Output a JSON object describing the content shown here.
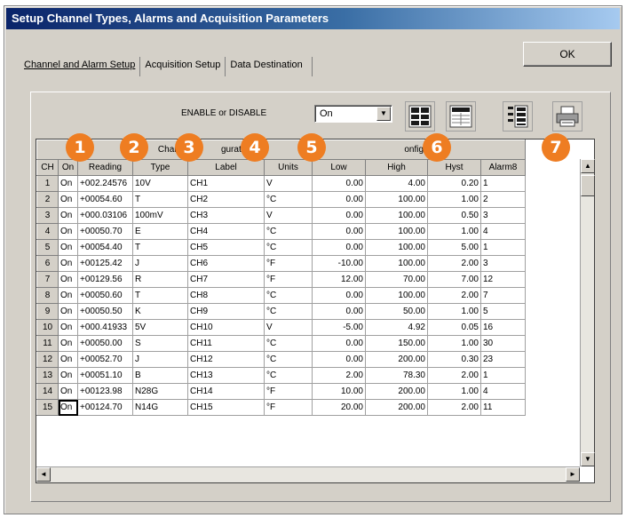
{
  "window": {
    "title": "Setup Channel Types, Alarms and Acquisition Parameters",
    "ok_label": "OK"
  },
  "tabs": [
    {
      "label": "Channel and Alarm Setup",
      "active": true
    },
    {
      "label": "Acquisition Setup",
      "active": false
    },
    {
      "label": "Data Destination",
      "active": false
    }
  ],
  "toolbar": {
    "enable_label": "ENABLE or DISABLE",
    "enable_value": "On",
    "icons": [
      "channel-grid-icon",
      "blank-grid-icon",
      "channel-list-icon",
      "printer-icon"
    ]
  },
  "grid": {
    "group_headers": [
      "Channel Configuration",
      "Alarm Configuration"
    ],
    "group_left_fragments": [
      "Channe",
      "guration"
    ],
    "group_right_fragment": "onfiguration",
    "columns": [
      "CH",
      "On",
      "Reading",
      "Type",
      "Label",
      "Units",
      "Low",
      "High",
      "Hyst",
      "Alarm#"
    ],
    "column_labels_shown": [
      "CH",
      "On",
      "Reading",
      "Type",
      "Label",
      "Units",
      "Low",
      "High",
      "Hyst",
      "Alarm8"
    ],
    "rows": [
      [
        "1",
        "On",
        "+002.24576",
        "10V",
        "CH1",
        "V",
        "0.00",
        "4.00",
        "0.20",
        "1"
      ],
      [
        "2",
        "On",
        "+00054.60",
        "T",
        "CH2",
        "°C",
        "0.00",
        "100.00",
        "1.00",
        "2"
      ],
      [
        "3",
        "On",
        "+000.03106",
        "100mV",
        "CH3",
        "V",
        "0.00",
        "100.00",
        "0.50",
        "3"
      ],
      [
        "4",
        "On",
        "+00050.70",
        "E",
        "CH4",
        "°C",
        "0.00",
        "100.00",
        "1.00",
        "4"
      ],
      [
        "5",
        "On",
        "+00054.40",
        "T",
        "CH5",
        "°C",
        "0.00",
        "100.00",
        "5.00",
        "1"
      ],
      [
        "6",
        "On",
        "+00125.42",
        "J",
        "CH6",
        "°F",
        "-10.00",
        "100.00",
        "2.00",
        "3"
      ],
      [
        "7",
        "On",
        "+00129.56",
        "R",
        "CH7",
        "°F",
        "12.00",
        "70.00",
        "7.00",
        "12"
      ],
      [
        "8",
        "On",
        "+00050.60",
        "T",
        "CH8",
        "°C",
        "0.00",
        "100.00",
        "2.00",
        "7"
      ],
      [
        "9",
        "On",
        "+00050.50",
        "K",
        "CH9",
        "°C",
        "0.00",
        "50.00",
        "1.00",
        "5"
      ],
      [
        "10",
        "On",
        "+000.41933",
        "5V",
        "CH10",
        "V",
        "-5.00",
        "4.92",
        "0.05",
        "16"
      ],
      [
        "11",
        "On",
        "+00050.00",
        "S",
        "CH11",
        "°C",
        "0.00",
        "150.00",
        "1.00",
        "30"
      ],
      [
        "12",
        "On",
        "+00052.70",
        "J",
        "CH12",
        "°C",
        "0.00",
        "200.00",
        "0.30",
        "23"
      ],
      [
        "13",
        "On",
        "+00051.10",
        "B",
        "CH13",
        "°C",
        "2.00",
        "78.30",
        "2.00",
        "1"
      ],
      [
        "14",
        "On",
        "+00123.98",
        "N28G",
        "CH14",
        "°F",
        "10.00",
        "200.00",
        "1.00",
        "4"
      ],
      [
        "15",
        "On",
        "+00124.70",
        "N14G",
        "CH15",
        "°F",
        "20.00",
        "200.00",
        "2.00",
        "11"
      ]
    ]
  },
  "callouts": [
    "1",
    "2",
    "3",
    "4",
    "5",
    "6",
    "7"
  ],
  "colors": {
    "callout": "#ee7d22",
    "title_bar_start": "#0a246a",
    "title_bar_end": "#a6caf0",
    "dialog_face": "#d4d0c8"
  }
}
